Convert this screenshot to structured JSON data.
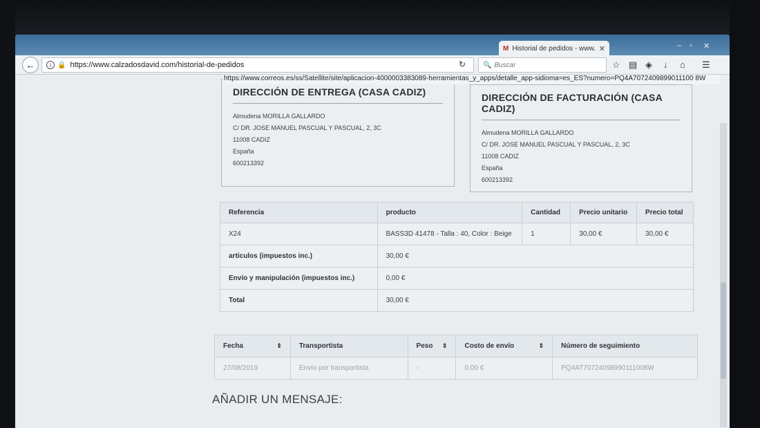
{
  "browser": {
    "tab_title": "Historial de pedidos - www...",
    "tab_favicon": "M",
    "url": "https://www.calzadosdavid.com/historial-de-pedidos",
    "search_placeholder": "Buscar",
    "status_url": "https://www.correos.es/ss/Satellite/site/aplicacion-4000003383089-herramientas_y_apps/detalle_app-sidioma=es_ES?numero=PQ4A7072409899011100 8W"
  },
  "delivery": {
    "title": "DIRECCIÓN DE ENTREGA (CASA CADIZ)",
    "lines": [
      "Almudena MORILLA GALLARDO",
      "C/ DR. JOSE MANUEL PASCUAL Y PASCUAL, 2, 3C",
      "11008 CADIZ",
      "España",
      "600213392"
    ]
  },
  "billing": {
    "title": "DIRECCIÓN DE FACTURACIÓN (CASA CADIZ)",
    "lines": [
      "Almudena MORILLA GALLARDO",
      "C/ DR. JOSE MANUEL PASCUAL Y PASCUAL, 2, 3C",
      "11008 CADIZ",
      "España",
      "600213392"
    ]
  },
  "products": {
    "headers": [
      "Referencia",
      "producto",
      "Cantidad",
      "Precio unitario",
      "Precio total"
    ],
    "rows": [
      {
        "ref": "X24",
        "product": "BASS3D 41478 - Talla : 40, Color : Beige",
        "qty": "1",
        "unit": "30,00 €",
        "total": "30,00 €"
      }
    ],
    "summary": [
      {
        "label": "artículos (impuestos inc.)",
        "value": "30,00 €"
      },
      {
        "label": "Envío y manipulación (impuestos inc.)",
        "value": "0,00 €"
      },
      {
        "label": "Total",
        "value": "30,00 €"
      }
    ]
  },
  "shipping": {
    "headers": [
      "Fecha",
      "Transportista",
      "Peso",
      "Costo de envío",
      "Número de seguimiento"
    ],
    "rows": [
      {
        "date": "27/08/2019",
        "carrier": "Envío por transportista",
        "weight": "-",
        "cost": "0,00 €",
        "tracking": "PQ4AT70724098990111008W"
      }
    ]
  },
  "message": {
    "title": "AÑADIR UN MENSAJE:"
  }
}
